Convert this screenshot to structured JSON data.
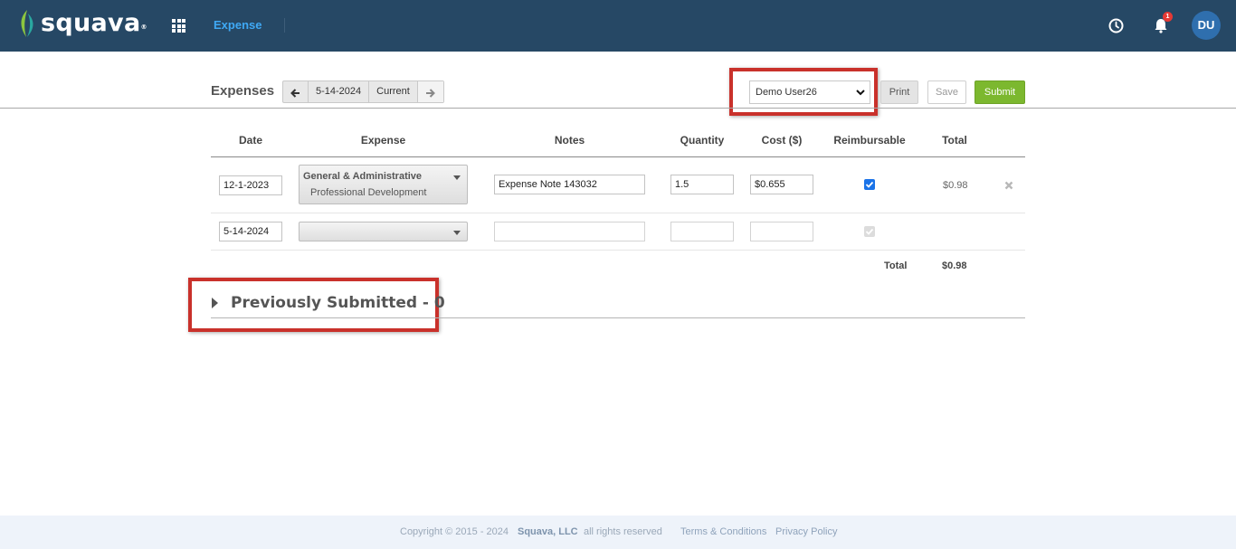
{
  "header": {
    "logo_text": "squava",
    "logo_mark": "®",
    "app_name": "Expense",
    "notification_count": "1",
    "avatar_initials": "DU",
    "colors": {
      "bar": "#264865",
      "app_name": "#3fa9f5",
      "badge": "#e53935",
      "avatar": "#2f6fae"
    }
  },
  "toolbar": {
    "title": "Expenses",
    "prev_icon": "arrow-left-icon",
    "date": "5-14-2024",
    "current_label": "Current",
    "next_icon": "arrow-right-icon",
    "user_selected": "Demo User26",
    "print_label": "Print",
    "save_label": "Save",
    "submit_label": "Submit",
    "colors": {
      "submit": "#7cb82f",
      "highlight": "#c9312b"
    }
  },
  "table": {
    "columns": [
      "Date",
      "Expense",
      "Notes",
      "Quantity",
      "Cost ($)",
      "Reimbursable",
      "Total"
    ],
    "rows": [
      {
        "date": "12-1-2023",
        "expense_category": "General & Administrative",
        "expense_subcategory": "Professional Development",
        "notes": "Expense Note 143032",
        "quantity": "1.5",
        "cost": "$0.655",
        "reimbursable": true,
        "total": "$0.98"
      },
      {
        "date": "5-14-2024",
        "expense_category": "",
        "expense_subcategory": "",
        "notes": "",
        "quantity": "",
        "cost": "",
        "reimbursable": false,
        "total": ""
      }
    ],
    "total_label": "Total",
    "total_value": "$0.98"
  },
  "previously_submitted": {
    "title": "Previously Submitted - 0"
  },
  "footer": {
    "copyright": "Copyright © 2015 - 2024",
    "company": "Squava, LLC",
    "rights": "all rights reserved",
    "terms": "Terms & Conditions",
    "privacy": "Privacy Policy"
  }
}
